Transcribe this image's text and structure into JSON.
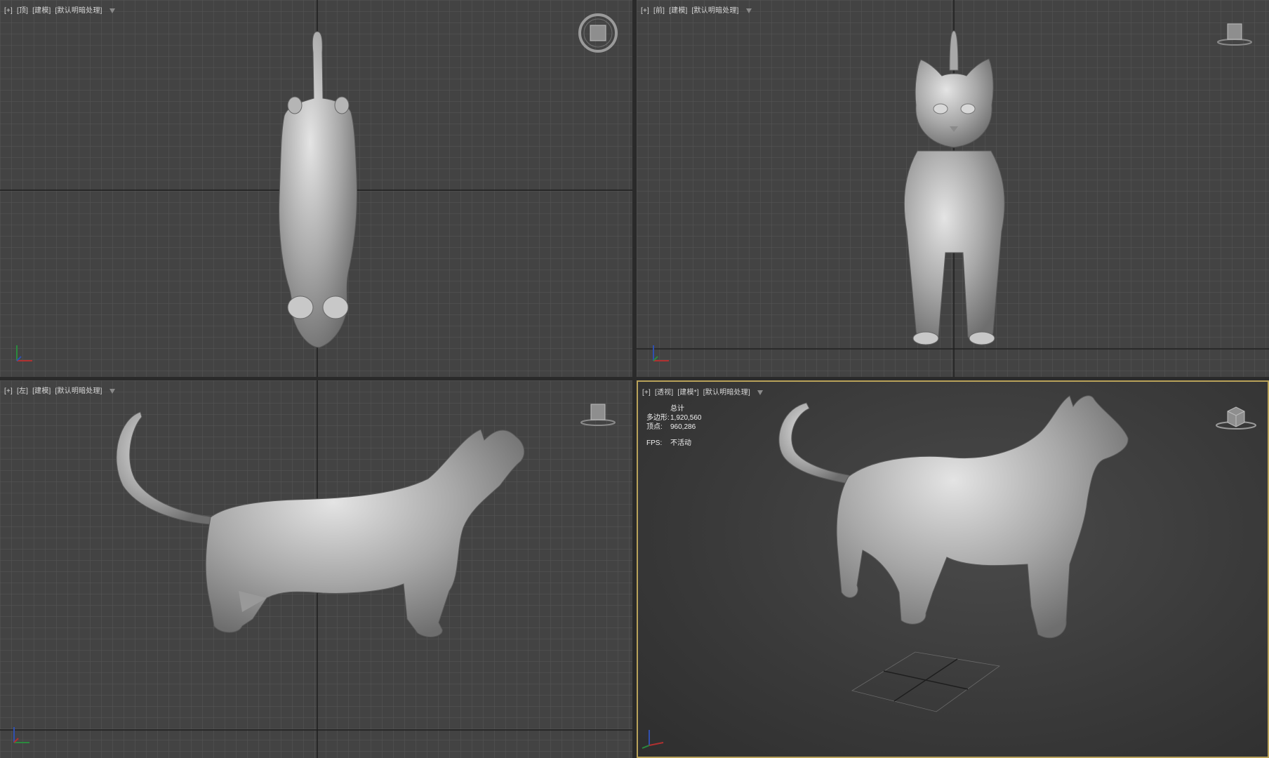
{
  "viewports": {
    "top": {
      "labels": [
        "[+]",
        "[顶]",
        "[建模]",
        "[默认明暗处理]"
      ]
    },
    "front": {
      "labels": [
        "[+]",
        "[前]",
        "[建模]",
        "[默认明暗处理]"
      ]
    },
    "left": {
      "labels": [
        "[+]",
        "[左]",
        "[建模]",
        "[默认明暗处理]"
      ]
    },
    "perspective": {
      "labels": [
        "[+]",
        "[透视]",
        "[建模*]",
        "[默认明暗处理]"
      ],
      "stats": {
        "header": "总计",
        "polygons_label": "多边形:",
        "polygons_value": "1,920,560",
        "vertices_label": "顶点:",
        "vertices_value": "960,286",
        "fps_label": "FPS:",
        "fps_value": "不活动"
      }
    }
  },
  "colors": {
    "grid_bg": "#434343",
    "grid_line": "#555555",
    "grid_major": "#1a1a1a",
    "active_border": "#b9a25a",
    "model": "#b8b8b8"
  },
  "icons": {
    "viewcube": "viewcube-icon",
    "axis": "axis-gizmo-icon",
    "filter": "filter-triangle-icon"
  }
}
